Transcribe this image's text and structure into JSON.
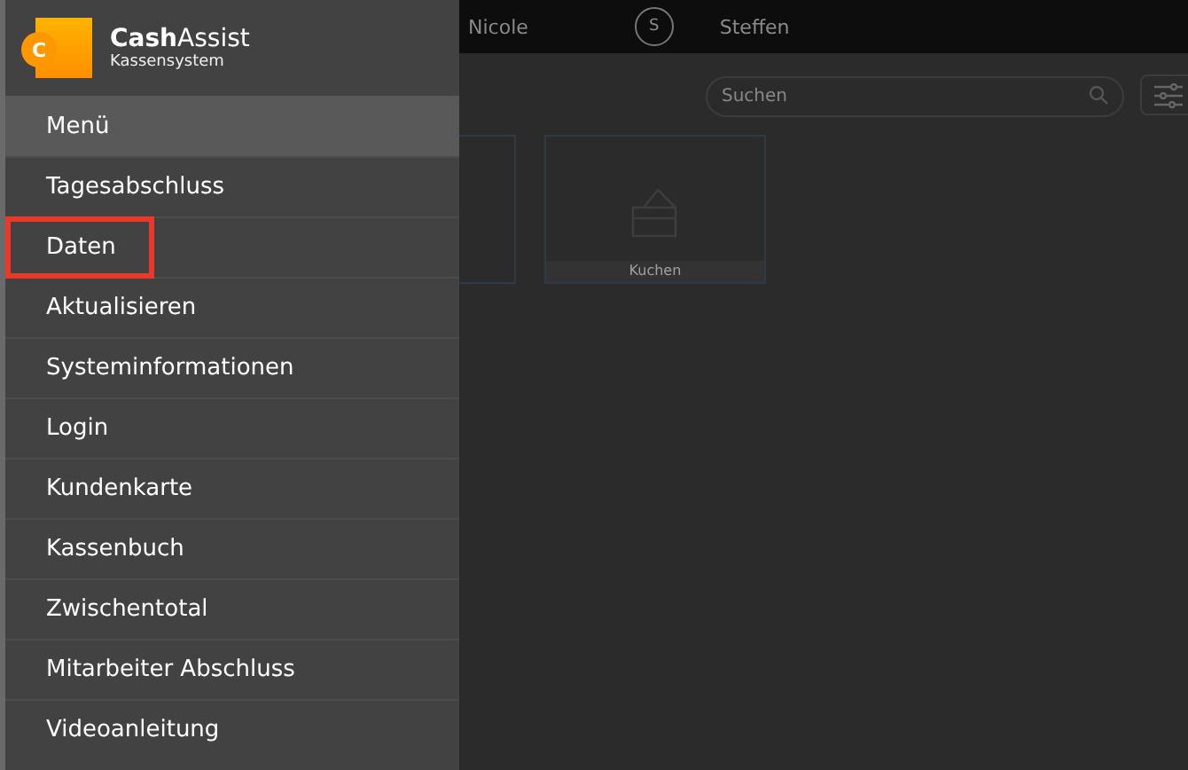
{
  "topbar": {
    "users": [
      {
        "name": "Nicole"
      },
      {
        "name": "Steffen",
        "initial": "S"
      }
    ]
  },
  "search": {
    "placeholder": "Suchen"
  },
  "categories": [
    {
      "kind": "partial"
    },
    {
      "kind": "full",
      "label": "Kuchen"
    }
  ],
  "drawer": {
    "brand": {
      "logo_letter": "C",
      "name_bold": "Cash",
      "name_rest": "Assist",
      "subtitle": "Kassensystem"
    },
    "menu_title": "Menü",
    "items": [
      {
        "label": "Tagesabschluss",
        "highlighted": false
      },
      {
        "label": "Daten",
        "highlighted": true
      },
      {
        "label": "Aktualisieren",
        "highlighted": false
      },
      {
        "label": "Systeminformationen",
        "highlighted": false
      },
      {
        "label": "Login",
        "highlighted": false
      },
      {
        "label": "Kundenkarte",
        "highlighted": false
      },
      {
        "label": "Kassenbuch",
        "highlighted": false
      },
      {
        "label": "Zwischentotal",
        "highlighted": false
      },
      {
        "label": "Mitarbeiter Abschluss",
        "highlighted": false
      },
      {
        "label": "Videoanleitung",
        "highlighted": false
      }
    ]
  }
}
